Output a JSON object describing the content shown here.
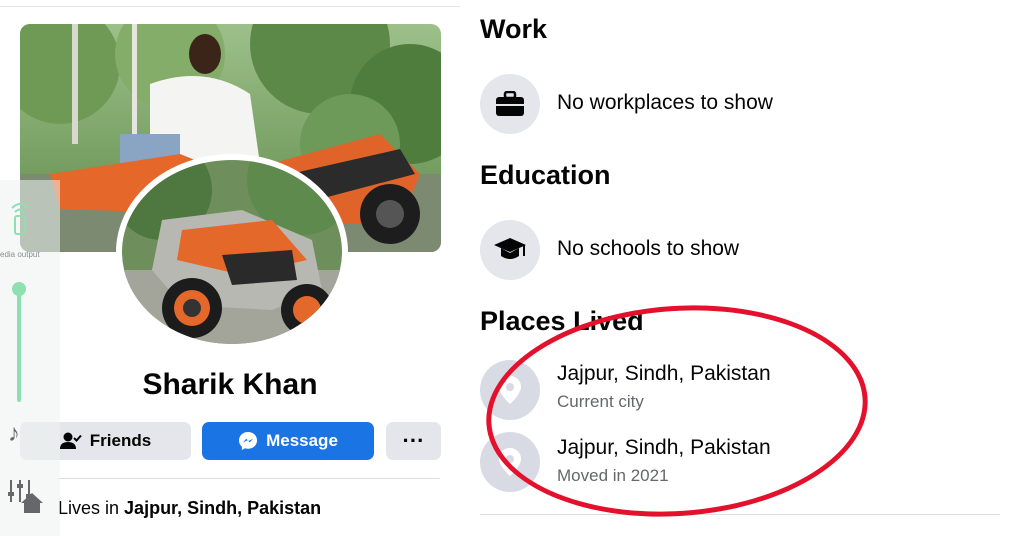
{
  "profile": {
    "name": "Sharik Khan",
    "actions": {
      "friends_label": "Friends",
      "message_label": "Message",
      "more_label": "···"
    },
    "lives_in": {
      "prefix": "Lives in",
      "place": "Jajpur, Sindh, Pakistan"
    }
  },
  "overlay": {
    "caption": "edia output"
  },
  "about": {
    "work": {
      "heading": "Work",
      "item": "No workplaces to show",
      "icon": "briefcase-icon"
    },
    "education": {
      "heading": "Education",
      "item": "No schools to show",
      "icon": "graduation-cap-icon"
    },
    "places_lived": {
      "heading": "Places Lived",
      "items": [
        {
          "place": "Jajpur, Sindh, Pakistan",
          "detail": "Current city",
          "icon": "location-pin-icon"
        },
        {
          "place": "Jajpur, Sindh, Pakistan",
          "detail": "Moved in 2021",
          "icon": "location-pin-icon"
        }
      ]
    }
  },
  "colors": {
    "primary_blue": "#1b74e4",
    "highlight_red": "#e3112b",
    "secondary_button": "#e4e6eb"
  }
}
